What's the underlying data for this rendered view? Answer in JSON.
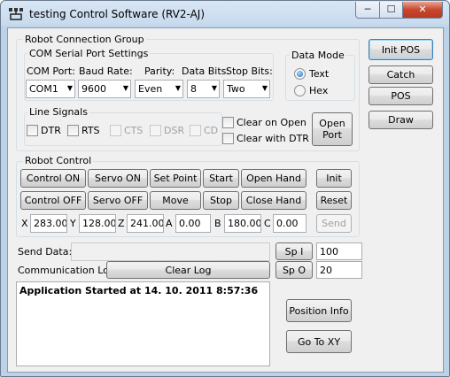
{
  "window": {
    "title": "testing Control Software   (RV2-AJ)",
    "min_label": "─",
    "max_label": "☐",
    "close_label": "✕"
  },
  "connection_group": {
    "title": "Robot Connection Group",
    "com_settings": {
      "title": "COM Serial Port Settings",
      "com_port_label": "COM Port:",
      "baud_rate_label": "Baud Rate:",
      "parity_label": "Parity:",
      "data_bits_label": "Data Bits:",
      "stop_bits_label": "Stop Bits:",
      "com_port_value": "COM1",
      "baud_rate_value": "9600",
      "parity_value": "Even",
      "data_bits_value": "8",
      "stop_bits_value": "Two"
    },
    "data_mode": {
      "title": "Data Mode",
      "text_label": "Text",
      "hex_label": "Hex",
      "selected": "Text"
    },
    "line_signals": {
      "title": "Line Signals",
      "dtr": "DTR",
      "rts": "RTS",
      "cts": "CTS",
      "dsr": "DSR",
      "cd": "CD",
      "clear_on_open": "Clear on Open",
      "clear_with_dtr": "Clear with DTR"
    },
    "open_port_label": "Open Port"
  },
  "robot_control": {
    "title": "Robot Control",
    "buttons": {
      "control_on": "Control ON",
      "servo_on": "Servo ON",
      "set_point": "Set Point",
      "start": "Start",
      "open_hand": "Open Hand",
      "init": "Init",
      "control_off": "Control OFF",
      "servo_off": "Servo OFF",
      "move": "Move",
      "stop": "Stop",
      "close_hand": "Close Hand",
      "reset": "Reset",
      "send": "Send"
    },
    "coords": {
      "x_label": "X",
      "x_value": "283.00",
      "y_label": "Y",
      "y_value": "128.00",
      "z_label": "Z",
      "z_value": "241.00",
      "a_label": "A",
      "a_value": "0.00",
      "b_label": "B",
      "b_value": "180.00",
      "c_label": "C",
      "c_value": "0.00"
    }
  },
  "side_buttons": {
    "init_pos": "Init POS",
    "catch": "Catch",
    "pos": "POS",
    "draw": "Draw"
  },
  "send_data": {
    "label": "Send Data:",
    "value": "",
    "sp_i_label": "Sp I",
    "sp_i_value": "100",
    "sp_o_label": "Sp O",
    "sp_o_value": "20"
  },
  "comm_log": {
    "label": "Communication Log",
    "clear_label": "Clear Log",
    "text": "Application Started at 14. 10. 2011 8:57:36"
  },
  "bottom_buttons": {
    "position_info": "Position Info",
    "go_to_xy": "Go To XY"
  }
}
